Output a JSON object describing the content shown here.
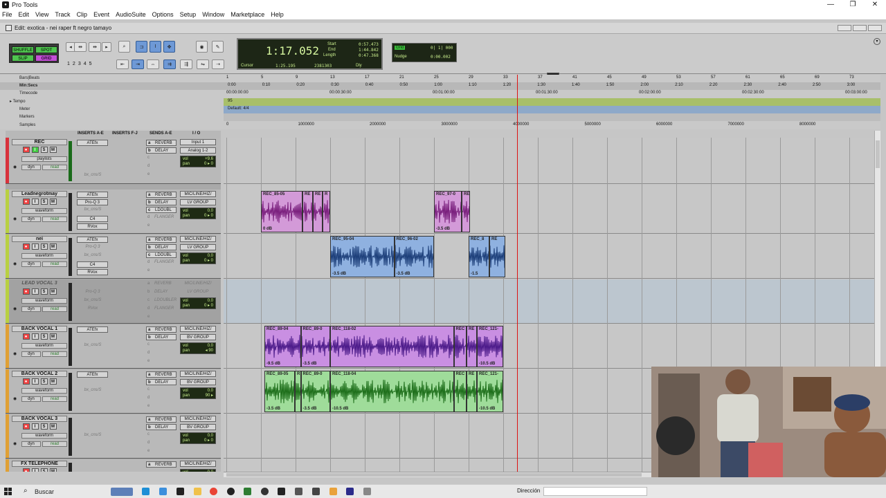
{
  "app": {
    "title": "Pro Tools",
    "window_controls": [
      "—",
      "❐",
      "✕"
    ]
  },
  "menu": [
    "File",
    "Edit",
    "View",
    "Track",
    "Clip",
    "Event",
    "AudioSuite",
    "Options",
    "Setup",
    "Window",
    "Marketplace",
    "Help"
  ],
  "edit_window": {
    "title": "Edit: exotica - nei raper ft negro tamayo"
  },
  "edit_modes": {
    "shuffle": "SHUFFLE",
    "spot": "SPOT",
    "slip": "SLIP",
    "grid": "GRID"
  },
  "zoom_presets": [
    "1",
    "2",
    "3",
    "4",
    "5"
  ],
  "counter": {
    "main": "1:17.052",
    "start_label": "Start",
    "start": "0:57.473",
    "end_label": "End",
    "end": "1:44.842",
    "length_label": "Length",
    "length": "0:47.368",
    "cursor_label": "Cursor",
    "cursor": "1:25.195",
    "samples": "2381303",
    "dly_label": "Dly"
  },
  "grid": {
    "label": "Grid",
    "value": "0| 1| 000",
    "nudge_label": "Nudge",
    "nudge_value": "0:00.002"
  },
  "rulers": {
    "bars_label": "Bars|Beats",
    "minsecs_label": "Min:Secs",
    "timecode_label": "Timecode",
    "tempo_label": "Tempo",
    "meter_label": "Meter",
    "markers_label": "Markers",
    "samples_label": "Samples",
    "tempo_value": "95",
    "meter_value": "Default: 4/4",
    "bars": [
      "1",
      "5",
      "9",
      "13",
      "17",
      "21",
      "25",
      "29",
      "33",
      "37",
      "41",
      "45",
      "49",
      "53",
      "57",
      "61",
      "65",
      "69",
      "73"
    ],
    "minsecs": [
      "0:00",
      "0:10",
      "0:20",
      "0:30",
      "0:40",
      "0:50",
      "1:00",
      "1:10",
      "1:20",
      "1:30",
      "1:40",
      "1:50",
      "2:00",
      "2:10",
      "2:20",
      "2:30",
      "2:40",
      "2:50",
      "3:00"
    ],
    "timecode": [
      "00:00:00:00",
      "00:00:30:00",
      "00:01:00:00",
      "00:01:30:00",
      "00:02:00:00",
      "00:02:30:00",
      "00:03:00:00"
    ],
    "samples": [
      "0",
      "1000000",
      "2000000",
      "3000000",
      "4000000",
      "5000000",
      "6000000",
      "7000000",
      "8000000"
    ]
  },
  "mix_header": {
    "inserts_ae": "INSERTS A-E",
    "inserts_fj": "INSERTS F-J",
    "sends_ae": "SENDS A-E",
    "io": "I / O"
  },
  "tracks": [
    {
      "name": "REC",
      "color": "#d8323c",
      "sel": "playlists",
      "dyn": "dyn",
      "read": "read",
      "inserts": [
        {
          "t": "ATEfx",
          "on": true
        },
        {
          "t": "",
          "on": false
        },
        {
          "t": "",
          "on": false
        },
        {
          "t": "",
          "on": false
        },
        {
          "t": "bx_cns/S",
          "on": false
        }
      ],
      "sends": [
        {
          "k": "a",
          "t": "REVERB",
          "on": true
        },
        {
          "k": "b",
          "t": "DELAY",
          "on": true
        },
        {
          "k": "c",
          "t": "",
          "on": false
        },
        {
          "k": "d",
          "t": "",
          "on": false
        },
        {
          "k": "e",
          "t": "",
          "on": false
        }
      ],
      "io": [
        "Input 1",
        "Analog 1-2"
      ],
      "vol": "+9.6",
      "pan": "0 ▸ 0",
      "inactive": false
    },
    {
      "name": "Leadnegrotmay",
      "color": "#b9d042",
      "sel": "waveform",
      "dyn": "dyn",
      "read": "read",
      "inserts": [
        {
          "t": "ATEfx",
          "on": true
        },
        {
          "t": "Pro-Q 3",
          "on": true
        },
        {
          "t": "bx_cns/S",
          "on": false
        },
        {
          "t": "C4",
          "on": true
        },
        {
          "t": "RVox",
          "on": true
        }
      ],
      "sends": [
        {
          "k": "a",
          "t": "REVERB",
          "on": true
        },
        {
          "k": "b",
          "t": "DELAY",
          "on": true
        },
        {
          "k": "c",
          "t": "LDOUBL",
          "on": true
        },
        {
          "k": "d",
          "t": "FLANGER",
          "on": false
        },
        {
          "k": "e",
          "t": "",
          "on": false
        }
      ],
      "io": [
        "MIC/LINE/HIZ/",
        "LV GROUP"
      ],
      "vol": "0.0",
      "pan": "0 ▸ 0",
      "inactive": false
    },
    {
      "name": "nei",
      "color": "#b9d042",
      "sel": "waveform",
      "dyn": "dyn",
      "read": "read",
      "inserts": [
        {
          "t": "ATEfx",
          "on": true
        },
        {
          "t": "Pro-Q 3",
          "on": false
        },
        {
          "t": "bx_cns/S",
          "on": false
        },
        {
          "t": "C4",
          "on": true
        },
        {
          "t": "RVox",
          "on": true
        }
      ],
      "sends": [
        {
          "k": "a",
          "t": "REVERB",
          "on": true
        },
        {
          "k": "b",
          "t": "DELAY",
          "on": true
        },
        {
          "k": "c",
          "t": "LDOUBL",
          "on": true
        },
        {
          "k": "d",
          "t": "FLANGER",
          "on": false
        },
        {
          "k": "e",
          "t": "",
          "on": false
        }
      ],
      "io": [
        "MIC/LINE/HIZ/",
        "LV GROUP"
      ],
      "vol": "0.0",
      "pan": "0 ▸ 0",
      "inactive": false
    },
    {
      "name": "LEAD VOCAL 3",
      "color": "#b9d042",
      "sel": "waveform",
      "dyn": "dyn",
      "read": "read",
      "inserts": [
        {
          "t": "",
          "on": false
        },
        {
          "t": "Pro-Q 3",
          "on": false
        },
        {
          "t": "bx_cns/S",
          "on": false
        },
        {
          "t": "RVox",
          "on": false
        },
        {
          "t": "",
          "on": false
        }
      ],
      "sends": [
        {
          "k": "a",
          "t": "REVERB",
          "on": false
        },
        {
          "k": "b",
          "t": "DELAY",
          "on": false
        },
        {
          "k": "c",
          "t": "LDOUBLER",
          "on": false
        },
        {
          "k": "d",
          "t": "FLANGER",
          "on": false
        },
        {
          "k": "e",
          "t": "",
          "on": false
        }
      ],
      "io": [
        "MIC/LINE/HIZ/",
        "LV GROUP"
      ],
      "vol": "0.0",
      "pan": "0 ▸ 0",
      "inactive": true
    },
    {
      "name": "BACK VOCAL 1",
      "color": "#e0a034",
      "sel": "waveform",
      "dyn": "dyn",
      "read": "read",
      "inserts": [
        {
          "t": "ATEfx",
          "on": true
        },
        {
          "t": "",
          "on": false
        },
        {
          "t": "bx_cns/S",
          "on": false
        },
        {
          "t": "",
          "on": false
        },
        {
          "t": "",
          "on": false
        }
      ],
      "sends": [
        {
          "k": "a",
          "t": "REVERB",
          "on": true
        },
        {
          "k": "b",
          "t": "DELAY",
          "on": true
        },
        {
          "k": "c",
          "t": "",
          "on": false
        },
        {
          "k": "d",
          "t": "",
          "on": false
        },
        {
          "k": "e",
          "t": "",
          "on": false
        }
      ],
      "io": [
        "MIC/LINE/HIZ/",
        "BV GROUP"
      ],
      "vol": "0.0",
      "pan": "◂ 90",
      "inactive": false
    },
    {
      "name": "BACK VOCAL 2",
      "color": "#e0a034",
      "sel": "waveform",
      "dyn": "dyn",
      "read": "read",
      "inserts": [
        {
          "t": "ATEfx",
          "on": true
        },
        {
          "t": "",
          "on": false
        },
        {
          "t": "bx_cns/S",
          "on": false
        },
        {
          "t": "",
          "on": false
        },
        {
          "t": "",
          "on": false
        }
      ],
      "sends": [
        {
          "k": "a",
          "t": "REVERB",
          "on": true
        },
        {
          "k": "b",
          "t": "DELAY",
          "on": true
        },
        {
          "k": "c",
          "t": "",
          "on": false
        },
        {
          "k": "d",
          "t": "",
          "on": false
        },
        {
          "k": "e",
          "t": "",
          "on": false
        }
      ],
      "io": [
        "MIC/LINE/HIZ/",
        "BV GROUP"
      ],
      "vol": "0.0",
      "pan": "90 ▸",
      "inactive": false
    },
    {
      "name": "BACK VOCAL 3",
      "color": "#e0a034",
      "sel": "waveform",
      "dyn": "dyn",
      "read": "read",
      "inserts": [
        {
          "t": "",
          "on": false
        },
        {
          "t": "",
          "on": false
        },
        {
          "t": "bx_cns/S",
          "on": false
        },
        {
          "t": "",
          "on": false
        },
        {
          "t": "",
          "on": false
        }
      ],
      "sends": [
        {
          "k": "a",
          "t": "REVERB",
          "on": true
        },
        {
          "k": "b",
          "t": "DELAY",
          "on": true
        },
        {
          "k": "c",
          "t": "",
          "on": false
        },
        {
          "k": "d",
          "t": "",
          "on": false
        },
        {
          "k": "e",
          "t": "",
          "on": false
        }
      ],
      "io": [
        "MIC/LINE/HIZ/",
        "BV GROUP"
      ],
      "vol": "0.0",
      "pan": "0 ▸ 0",
      "inactive": false
    },
    {
      "name": "FX TELEPHONE",
      "color": "#e0a034",
      "sel": "waveform",
      "dyn": "dyn",
      "read": "read",
      "inserts": [
        {
          "t": "",
          "on": false
        }
      ],
      "sends": [
        {
          "k": "a",
          "t": "REVERB",
          "on": true
        }
      ],
      "io": [
        "MIC/LINE/HIZ/"
      ],
      "vol": "0.0",
      "pan": "0 ▸ 0",
      "inactive": false
    }
  ],
  "clips": [
    {
      "track": 1,
      "name": "REC_85-05",
      "gain": "0 dB",
      "color": "#d39ad8",
      "wave": "#7a1f7d",
      "start": 1,
      "end": 2.2
    },
    {
      "track": 1,
      "name": "RE",
      "gain": "",
      "color": "#d39ad8",
      "wave": "#7a1f7d",
      "start": 2.2,
      "end": 2.5
    },
    {
      "track": 1,
      "name": "RE",
      "gain": "",
      "color": "#d39ad8",
      "wave": "#7a1f7d",
      "start": 2.5,
      "end": 2.78
    },
    {
      "track": 1,
      "name": "R",
      "gain": "",
      "color": "#d39ad8",
      "wave": "#7a1f7d",
      "start": 2.78,
      "end": 3.0
    },
    {
      "track": 1,
      "name": "REC_97-0",
      "gain": "-3.5 dB",
      "color": "#d39ad8",
      "wave": "#7a1f7d",
      "start": 6.0,
      "end": 6.8
    },
    {
      "track": 1,
      "name": "RE",
      "gain": "",
      "color": "#d39ad8",
      "wave": "#7a1f7d",
      "start": 6.8,
      "end": 7.04
    },
    {
      "track": 2,
      "name": "REC_95-04",
      "gain": "-3.5 dB",
      "color": "#8fb1e0",
      "wave": "#1d3f7a",
      "start": 3.0,
      "end": 4.85
    },
    {
      "track": 2,
      "name": "REC_96-02",
      "gain": "-3.5 dB",
      "color": "#8fb1e0",
      "wave": "#1d3f7a",
      "start": 4.85,
      "end": 6.0
    },
    {
      "track": 2,
      "name": "REC_8",
      "gain": "-1.5",
      "color": "#8fb1e0",
      "wave": "#1d3f7a",
      "start": 7.0,
      "end": 7.6
    },
    {
      "track": 2,
      "name": "RE",
      "gain": "",
      "color": "#8fb1e0",
      "wave": "#1d3f7a",
      "start": 7.6,
      "end": 8.05
    },
    {
      "track": 4,
      "name": "REC_89-04",
      "gain": "-9.5 dB",
      "color": "#c98fe2",
      "wave": "#4c1b8a",
      "start": 1.1,
      "end": 2.15
    },
    {
      "track": 4,
      "name": "REC_89-0",
      "gain": "-3.5 dB",
      "color": "#c98fe2",
      "wave": "#4c1b8a",
      "start": 2.15,
      "end": 3.0
    },
    {
      "track": 4,
      "name": "REC_118-02",
      "gain": "",
      "color": "#c98fe2",
      "wave": "#4c1b8a",
      "start": 3.0,
      "end": 6.57
    },
    {
      "track": 4,
      "name": "REC",
      "gain": "",
      "color": "#c98fe2",
      "wave": "#4c1b8a",
      "start": 6.57,
      "end": 6.94
    },
    {
      "track": 4,
      "name": "RE",
      "gain": "",
      "color": "#c98fe2",
      "wave": "#4c1b8a",
      "start": 6.94,
      "end": 7.24
    },
    {
      "track": 4,
      "name": "REC_121-",
      "gain": "-10.5 dB",
      "color": "#c98fe2",
      "wave": "#4c1b8a",
      "start": 7.24,
      "end": 8.0
    },
    {
      "track": 5,
      "name": "REC_89-05",
      "gain": "-3.5 dB",
      "color": "#9fdc9a",
      "wave": "#1d6e1a",
      "start": 1.1,
      "end": 1.98
    },
    {
      "track": 5,
      "name": "R",
      "gain": "",
      "color": "#9fdc9a",
      "wave": "#1d6e1a",
      "start": 1.98,
      "end": 2.15
    },
    {
      "track": 5,
      "name": "REC_89-0",
      "gain": "-3.5 dB",
      "color": "#9fdc9a",
      "wave": "#1d6e1a",
      "start": 2.15,
      "end": 3.0
    },
    {
      "track": 5,
      "name": "REC_118-04",
      "gain": "-10.5 dB",
      "color": "#9fdc9a",
      "wave": "#1d6e1a",
      "start": 3.0,
      "end": 6.57
    },
    {
      "track": 5,
      "name": "REC",
      "gain": "",
      "color": "#9fdc9a",
      "wave": "#1d6e1a",
      "start": 6.57,
      "end": 6.94
    },
    {
      "track": 5,
      "name": "RE",
      "gain": "",
      "color": "#9fdc9a",
      "wave": "#1d6e1a",
      "start": 6.94,
      "end": 7.24
    },
    {
      "track": 5,
      "name": "REC_121-",
      "gain": "-10.5 dB",
      "color": "#9fdc9a",
      "wave": "#1d6e1a",
      "start": 7.24,
      "end": 8.0
    }
  ],
  "taskbar": {
    "search_placeholder": "Buscar",
    "direccion_label": "Dirección"
  }
}
